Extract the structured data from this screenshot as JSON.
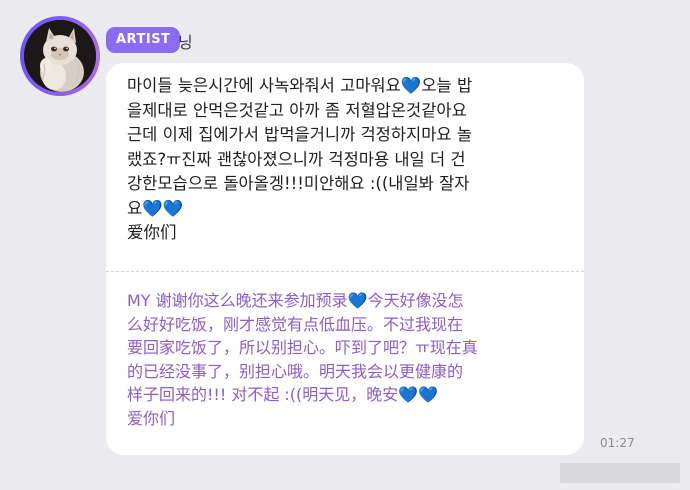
{
  "post": {
    "author_badge": "ARTIST",
    "author_name": "닝",
    "message_korean": "마이들 늦은시간에 사녹와줘서 고마워요💙오늘 밥\n을제대로 안먹은것같고 아까 좀 저혈압온것같아요\n근데 이제 집에가서 밥먹을거니까 걱정하지마요 놀\n랬죠?ㅠ진짜 괜찮아졌으니까 걱정마용 내일 더 건\n강한모습으로 돌아올겡!!!미안해요 :((내일봐 잘자\n요💙💙\n爱你们",
    "message_translation": "MY 谢谢你这么晚还来参加预录💙今天好像没怎\n么好好吃饭，刚才感觉有点低血压。不过我现在\n要回家吃饭了，所以别担心。吓到了吧？ㅠ现在真\n的已经没事了，别担心哦。明天我会以更健康的\n样子回来的!!!  对不起 :((明天见，晚安💙💙\n爱你们",
    "timestamp": "01:27"
  },
  "icons": {
    "avatar": "cat-avatar-image",
    "badge_color": "#8b6cf0",
    "translation_color": "#8d5ec4"
  }
}
